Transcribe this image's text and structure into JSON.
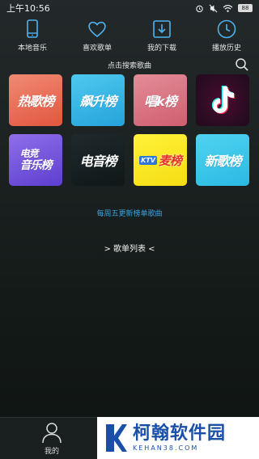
{
  "status_bar": {
    "time": "上午10:56",
    "battery": "88",
    "icons": [
      "alarm-icon",
      "mute-icon",
      "wifi-icon",
      "battery-icon"
    ]
  },
  "top_nav": [
    {
      "label": "本地音乐",
      "icon": "phone-icon"
    },
    {
      "label": "喜欢歌单",
      "icon": "heart-icon"
    },
    {
      "label": "我的下载",
      "icon": "download-icon"
    },
    {
      "label": "播放历史",
      "icon": "clock-icon"
    }
  ],
  "search": {
    "hint": "点击搜索歌曲",
    "icon": "search-icon"
  },
  "charts": [
    {
      "key": "hot",
      "label": "热歌榜",
      "color": "#e2563f"
    },
    {
      "key": "surge",
      "label": "飙升榜",
      "color": "#25a3db"
    },
    {
      "key": "sing",
      "label": "唱k榜",
      "color": "#cf5e70"
    },
    {
      "key": "tiktok",
      "label": "",
      "icon": "tiktok-logo-icon",
      "color": "#2a0c22"
    },
    {
      "key": "esports",
      "label_line1": "电竞",
      "label_line2": "音乐榜",
      "color": "#5d3fd1"
    },
    {
      "key": "electronic",
      "label": "电音榜",
      "color": "#0f1718"
    },
    {
      "key": "ktv",
      "badge": "KTV",
      "label": "麦榜",
      "color": "#f5dd12"
    },
    {
      "key": "new",
      "label": "新歌榜",
      "color": "#2ab9e3"
    }
  ],
  "update_note": "每周五更新榜单歌曲",
  "playlist_link": "> 歌单列表 <",
  "bottom_bar": {
    "tab_label": "我的",
    "tab_icon": "user-icon"
  },
  "watermark": {
    "title": "柯翰软件园",
    "subtitle": "KEHAN38.COM"
  },
  "colors": {
    "accent": "#3aa3e0",
    "background": "#1d2322",
    "watermark_blue": "#1a4fa8"
  }
}
